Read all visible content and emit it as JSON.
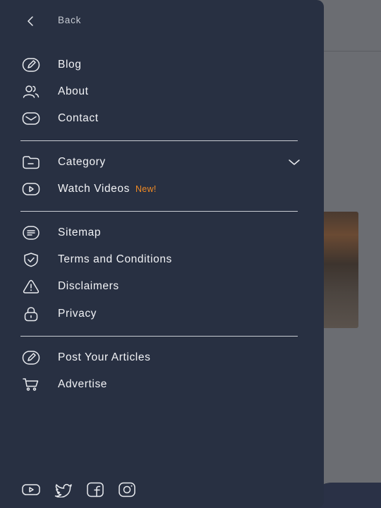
{
  "drawer": {
    "back_label": "Back",
    "section1": [
      {
        "label": "Blog",
        "icon": "pencil-circle-icon"
      },
      {
        "label": "About",
        "icon": "users-icon"
      },
      {
        "label": "Contact",
        "icon": "mail-icon"
      }
    ],
    "section2": {
      "category_label": "Category",
      "watch_videos_label": "Watch Videos",
      "new_badge": "New!"
    },
    "section3": [
      {
        "label": "Sitemap",
        "icon": "list-icon"
      },
      {
        "label": "Terms and Conditions",
        "icon": "shield-check-icon"
      },
      {
        "label": "Disclaimers",
        "icon": "warning-icon"
      },
      {
        "label": "Privacy",
        "icon": "lock-icon"
      }
    ],
    "section4": [
      {
        "label": "Post Your Articles",
        "icon": "pencil-circle-icon"
      },
      {
        "label": "Advertise",
        "icon": "cart-icon"
      }
    ],
    "social": [
      "youtube-icon",
      "twitter-icon",
      "facebook-icon",
      "instagram-icon"
    ]
  },
  "colors": {
    "drawer_bg": "#283042",
    "text": "#f2f3f6",
    "badge": "#f08a24"
  }
}
